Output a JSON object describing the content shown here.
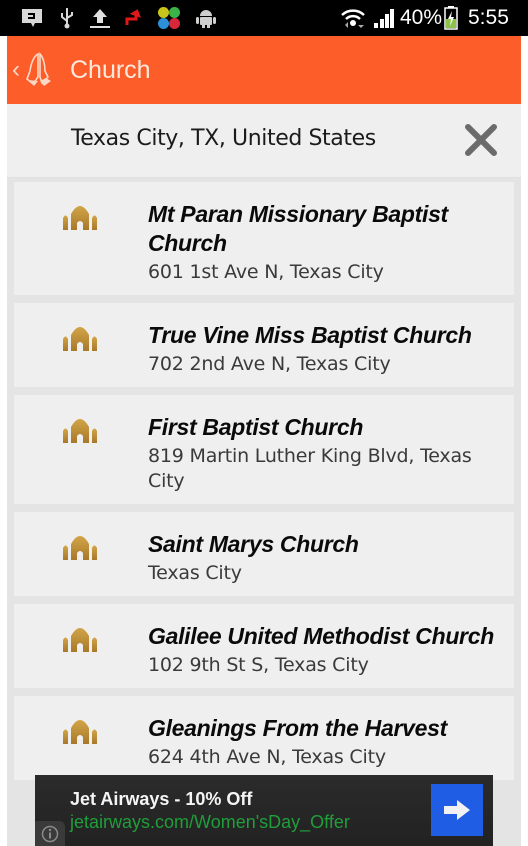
{
  "status_bar": {
    "left_icons": [
      "message-icon",
      "usb-icon",
      "upload-icon",
      "red-arrow-icon",
      "clover-app-icon",
      "android-icon"
    ],
    "wifi": "wifi-icon",
    "signal": "signal-icon",
    "battery_percent": "40%",
    "battery_icon": "battery-charging-icon",
    "time": "5:55"
  },
  "action_bar": {
    "title": "Church",
    "back_icon": "chevron-left-icon",
    "app_icon": "praying-hands-icon",
    "background_color": "#fc5d29"
  },
  "search": {
    "location": "Texas City, TX, United States",
    "clear_icon": "close-icon"
  },
  "results": [
    {
      "name": "Mt Paran Missionary Baptist Church",
      "address": "601 1st Ave N, Texas City",
      "icon": "church-icon"
    },
    {
      "name": "True Vine Miss Baptist Church",
      "address": "702 2nd Ave N, Texas City",
      "icon": "church-icon"
    },
    {
      "name": "First Baptist Church",
      "address": "819 Martin Luther King Blvd, Texas City",
      "icon": "church-icon"
    },
    {
      "name": "Saint Marys Church",
      "address": "Texas City",
      "icon": "church-icon"
    },
    {
      "name": "Galilee United Methodist Church",
      "address": "102 9th St S, Texas City",
      "icon": "church-icon"
    },
    {
      "name": "Gleanings From the Harvest",
      "address": "624 4th Ave N, Texas City",
      "icon": "church-icon"
    }
  ],
  "ad": {
    "title": "Jet Airways - 10% Off",
    "url": "jetairways.com/Women'sDay_Offer",
    "info_icon": "info-icon",
    "cta_icon": "arrow-right-icon",
    "url_color": "#1f9e3a",
    "cta_color": "#1f5ee4"
  },
  "colors": {
    "icon_gold": "#b8862e",
    "list_background": "#e4e4e4",
    "item_background": "#efefef"
  }
}
